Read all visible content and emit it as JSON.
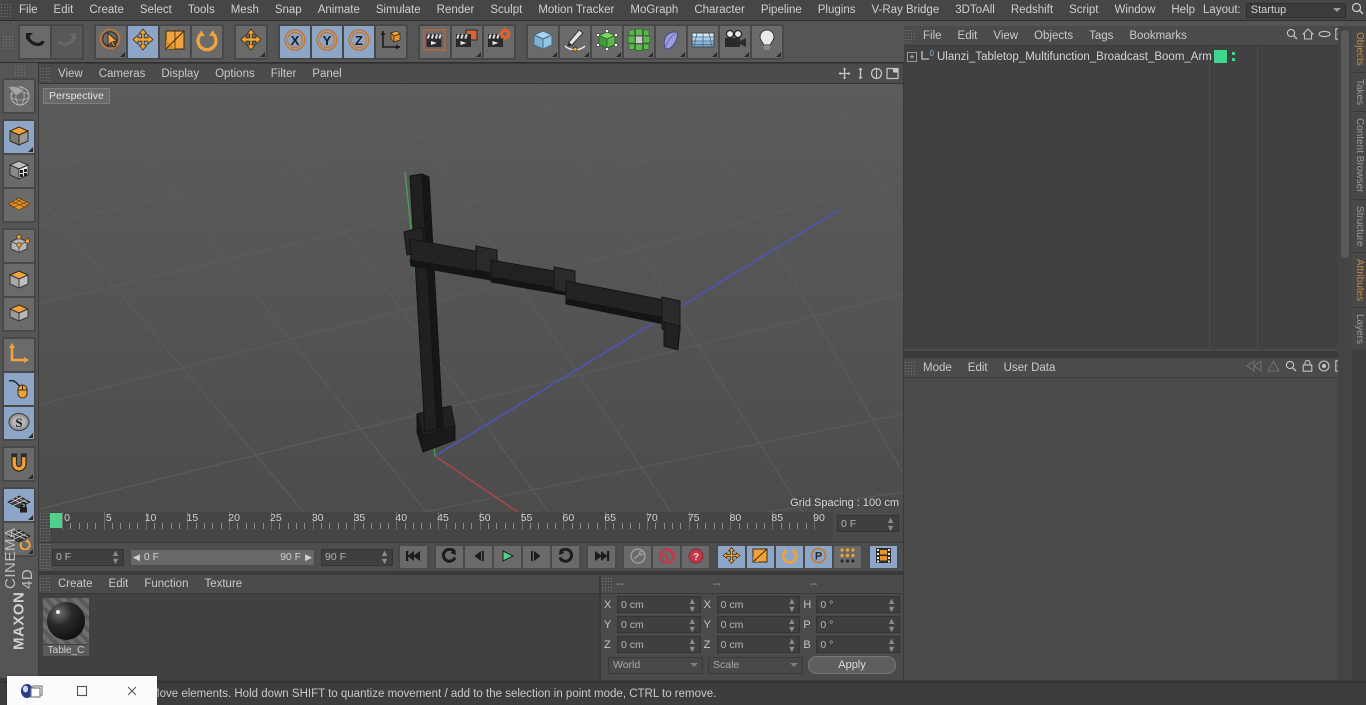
{
  "app": {
    "title": "CINEMA 4D",
    "brand_top": "MAXON"
  },
  "top_menu": {
    "items": [
      "File",
      "Edit",
      "Create",
      "Select",
      "Tools",
      "Mesh",
      "Snap",
      "Animate",
      "Simulate",
      "Render",
      "Sculpt",
      "Motion Tracker",
      "MoGraph",
      "Character",
      "Pipeline",
      "Plugins",
      "V-Ray Bridge",
      "3DToAll",
      "Redshift",
      "Script",
      "Window",
      "Help"
    ],
    "layout_label": "Layout:",
    "layout_value": "Startup",
    "search_icon": "magnifier-icon"
  },
  "toolbar": {
    "groups": [
      {
        "name": "undo-redo",
        "buttons": [
          {
            "name": "undo-button",
            "icon": "undo-arrow-icon",
            "selected": false,
            "corner": false,
            "dim": false
          },
          {
            "name": "redo-button",
            "icon": "redo-arrow-icon",
            "selected": false,
            "corner": false,
            "dim": true
          }
        ]
      },
      {
        "name": "transform-tools",
        "buttons": [
          {
            "name": "live-selection-tool",
            "icon": "cursor-circle-icon",
            "selected": false,
            "corner": true,
            "dim": false
          },
          {
            "name": "move-tool",
            "icon": "move-arrows-icon",
            "selected": true,
            "corner": false,
            "dim": false
          },
          {
            "name": "scale-tool",
            "icon": "scale-box-icon",
            "selected": false,
            "corner": false,
            "dim": false
          },
          {
            "name": "rotate-tool",
            "icon": "rotate-arrows-icon",
            "selected": false,
            "corner": false,
            "dim": false
          }
        ]
      },
      {
        "name": "move-duplicate",
        "buttons": [
          {
            "name": "move-tool-secondary",
            "icon": "move-arrows-icon",
            "selected": false,
            "corner": true,
            "dim": false
          }
        ]
      },
      {
        "name": "axis-locks",
        "buttons": [
          {
            "name": "lock-x-axis-button",
            "icon": "x-axis-icon",
            "selected": true,
            "corner": false,
            "dim": false
          },
          {
            "name": "lock-y-axis-button",
            "icon": "y-axis-icon",
            "selected": true,
            "corner": false,
            "dim": false
          },
          {
            "name": "lock-z-axis-button",
            "icon": "z-axis-icon",
            "selected": true,
            "corner": false,
            "dim": false
          },
          {
            "name": "world-object-axis-button",
            "icon": "world-axis-cube-icon",
            "selected": false,
            "corner": false,
            "dim": false
          }
        ]
      },
      {
        "name": "render-tools",
        "buttons": [
          {
            "name": "render-view-button",
            "icon": "clapper-icon",
            "selected": false,
            "corner": false,
            "dim": false
          },
          {
            "name": "render-to-picture-viewer-button",
            "icon": "clapper-picture-icon",
            "selected": false,
            "corner": true,
            "dim": false
          },
          {
            "name": "render-settings-button",
            "icon": "clapper-gear-icon",
            "selected": false,
            "corner": false,
            "dim": false
          }
        ]
      },
      {
        "name": "create-objects",
        "buttons": [
          {
            "name": "add-cube-button",
            "icon": "blue-cube-icon",
            "selected": false,
            "corner": true,
            "dim": false
          },
          {
            "name": "add-spline-button",
            "icon": "pen-spline-icon",
            "selected": false,
            "corner": true,
            "dim": false
          },
          {
            "name": "add-generator-button",
            "icon": "green-cube-points-icon",
            "selected": false,
            "corner": true,
            "dim": false
          },
          {
            "name": "add-array-button",
            "icon": "green-cluster-icon",
            "selected": false,
            "corner": true,
            "dim": false
          },
          {
            "name": "add-deformer-button",
            "icon": "bend-deformer-icon",
            "selected": false,
            "corner": true,
            "dim": false
          },
          {
            "name": "add-environment-button",
            "icon": "floor-grid-icon",
            "selected": false,
            "corner": true,
            "dim": false
          },
          {
            "name": "add-camera-button",
            "icon": "camera-icon",
            "selected": false,
            "corner": true,
            "dim": false
          },
          {
            "name": "add-light-button",
            "icon": "light-bulb-icon",
            "selected": false,
            "corner": true,
            "dim": false
          }
        ]
      }
    ]
  },
  "left_toolbar": {
    "groups": [
      {
        "buttons": [
          {
            "name": "undo-view-button",
            "icon": "globe-grid-icon",
            "selected": false,
            "corner": false
          }
        ]
      },
      {
        "buttons": [
          {
            "name": "editable-object-button",
            "icon": "orange-cube-icon",
            "selected": true,
            "corner": true
          },
          {
            "name": "texture-axis-button",
            "icon": "checker-cube-icon",
            "selected": false,
            "corner": false
          },
          {
            "name": "viewport-solo-button",
            "icon": "orange-mesh-plane-icon",
            "selected": false,
            "corner": false
          }
        ]
      },
      {
        "buttons": [
          {
            "name": "point-mode-button",
            "icon": "cube-points-icon",
            "selected": false,
            "corner": false
          },
          {
            "name": "edge-mode-button",
            "icon": "cube-edges-icon",
            "selected": false,
            "corner": false
          },
          {
            "name": "polygon-mode-button",
            "icon": "cube-polygon-icon",
            "selected": false,
            "corner": false
          }
        ]
      },
      {
        "buttons": [
          {
            "name": "object-axis-mode-button",
            "icon": "axis-L-icon",
            "selected": false,
            "corner": false
          },
          {
            "name": "enable-axis-modification-button",
            "icon": "mouse-spline-icon",
            "selected": true,
            "corner": false
          },
          {
            "name": "soft-selection-button",
            "icon": "s-disc-icon",
            "selected": true,
            "corner": true
          }
        ]
      },
      {
        "buttons": [
          {
            "name": "snap-magnet-button",
            "icon": "magnet-icon",
            "selected": false,
            "corner": true
          }
        ]
      },
      {
        "buttons": [
          {
            "name": "lock-workplane-button",
            "icon": "grid-lock-icon",
            "selected": true,
            "corner": true
          },
          {
            "name": "workplane-rotate-button",
            "icon": "grid-rotate-icon",
            "selected": false,
            "corner": true
          }
        ]
      }
    ]
  },
  "viewport": {
    "menu": [
      "View",
      "Cameras",
      "Display",
      "Options",
      "Filter",
      "Panel"
    ],
    "corner_icons": [
      "move-view-icon",
      "zoom-view-icon",
      "rotate-view-icon",
      "maximize-view-icon"
    ],
    "label": "Perspective",
    "grid_spacing": "Grid Spacing : 100 cm",
    "axis_labels": {
      "x": "X",
      "y": "Y",
      "z": "Z"
    }
  },
  "timeline": {
    "ticks": [
      0,
      5,
      10,
      15,
      20,
      25,
      30,
      35,
      40,
      45,
      50,
      55,
      60,
      65,
      70,
      75,
      80,
      85,
      90
    ],
    "range_start": 0,
    "range_end": 90,
    "current_frame_value": "0 F"
  },
  "transport": {
    "start_field": "0 F",
    "preview_min": "0 F",
    "preview_max": "90 F",
    "end_field": "90 F",
    "buttons": [
      {
        "name": "go-to-start-button",
        "icon": "skip-start-icon",
        "selected": false
      },
      {
        "name": "play-backwards-step-button",
        "icon": "rewind-loop-icon",
        "selected": false
      },
      {
        "name": "previous-frame-button",
        "icon": "step-back-icon",
        "selected": false
      },
      {
        "name": "play-button",
        "icon": "play-triangle-icon",
        "selected": false
      },
      {
        "name": "next-frame-button",
        "icon": "step-forward-icon",
        "selected": false
      },
      {
        "name": "play-forwards-loop-button",
        "icon": "forward-loop-icon",
        "selected": false
      },
      {
        "name": "go-to-end-button",
        "icon": "skip-end-icon",
        "selected": false
      },
      {
        "name": "record-active-objects-button",
        "icon": "key-icon",
        "selected": false
      },
      {
        "name": "autokeying-button",
        "icon": "red-circle-arrows-icon",
        "selected": false
      },
      {
        "name": "keyframe-selection-button",
        "icon": "red-question-icon",
        "selected": false
      },
      {
        "name": "position-key-button",
        "icon": "move-arrows-icon",
        "selected": true
      },
      {
        "name": "scale-key-button",
        "icon": "scale-box-icon",
        "selected": true
      },
      {
        "name": "rotation-key-button",
        "icon": "rotate-arrows-icon",
        "selected": true
      },
      {
        "name": "parameter-key-button",
        "icon": "p-circle-icon",
        "selected": true
      },
      {
        "name": "pla-key-button",
        "icon": "dot-matrix-icon",
        "selected": false
      },
      {
        "name": "timeline-button",
        "icon": "film-strip-icon",
        "selected": true
      }
    ]
  },
  "material_manager": {
    "menu": [
      "Create",
      "Edit",
      "Function",
      "Texture"
    ],
    "materials": [
      {
        "name": "Table_C"
      }
    ]
  },
  "coordinates": {
    "headers": [
      "--",
      "--",
      "--"
    ],
    "rows": [
      {
        "l1": "X",
        "v1": "0 cm",
        "l2": "X",
        "v2": "0 cm",
        "l3": "H",
        "v3": "0 °"
      },
      {
        "l1": "Y",
        "v1": "0 cm",
        "l2": "Y",
        "v2": "0 cm",
        "l3": "P",
        "v3": "0 °"
      },
      {
        "l1": "Z",
        "v1": "0 cm",
        "l2": "Z",
        "v2": "0 cm",
        "l3": "B",
        "v3": "0 °"
      }
    ],
    "system": "World",
    "mode": "Scale",
    "apply_label": "Apply"
  },
  "object_manager": {
    "menu": [
      "File",
      "Edit",
      "View",
      "Objects",
      "Tags",
      "Bookmarks"
    ],
    "icons": [
      "magnifier-icon",
      "home-icon",
      "eye-icon",
      "plus-box-icon"
    ],
    "objects": [
      {
        "name": "Ulanzi_Tabletop_Multifunction_Broadcast_Boom_Arm",
        "level": 0,
        "badge": "0"
      }
    ]
  },
  "attributes_manager": {
    "menu": [
      "Mode",
      "Edit",
      "User Data"
    ],
    "icons": [
      "back-nav-icon",
      "forward-nav-icon",
      "magnifier-icon",
      "lock-icon",
      "target-icon",
      "plus-box-icon"
    ]
  },
  "right_tabs": [
    {
      "label": "Objects",
      "accent": true
    },
    {
      "label": "Takes",
      "accent": false
    },
    {
      "label": "Content Browser",
      "accent": false
    },
    {
      "label": "Structure",
      "accent": false
    },
    {
      "label": "Attributes",
      "accent": true
    },
    {
      "label": "Layers",
      "accent": false
    }
  ],
  "status_bar": {
    "text": "Move elements. Hold down SHIFT to quantize movement / add to the selection in point mode, CTRL to remove."
  },
  "taskbar": {
    "items": [
      "app-icon",
      "restore-window-icon",
      "maximize-window-icon",
      "close-window-icon"
    ]
  },
  "colors": {
    "accent_orange": "#e8922c",
    "selection_blue": "#8da6c8",
    "green_tag": "#3fd78f",
    "panel_bg": "#4a4a4a",
    "viewport_bg": "#525252"
  }
}
